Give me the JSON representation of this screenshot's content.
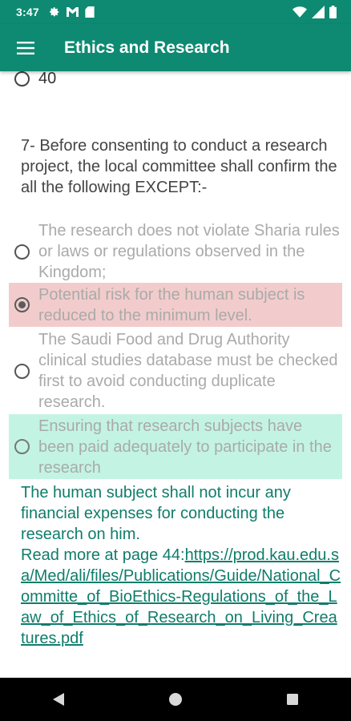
{
  "status_bar": {
    "time": "3:47",
    "left_icons": [
      "gear-icon",
      "gmail-icon",
      "sd-card-icon"
    ],
    "right_icons": [
      "wifi-icon",
      "signal-icon",
      "battery-icon"
    ]
  },
  "app_bar": {
    "title": "Ethics and Research",
    "menu_icon": "hamburger-menu-icon"
  },
  "prev_option": {
    "text": "40"
  },
  "question": {
    "text": "7- Before consenting to conduct a research project, the local committee shall confirm the all the following EXCEPT:-"
  },
  "options": [
    {
      "text": "The research does not violate Sharia rules or laws or regulations observed in the Kingdom;",
      "state": "normal",
      "selected": false
    },
    {
      "text": "Potential risk for the human subject is reduced to the minimum level.",
      "state": "wrong",
      "selected": true
    },
    {
      "text": "The Saudi Food and Drug Authority clinical studies database must be checked first to avoid conducting duplicate research.",
      "state": "normal",
      "selected": false
    },
    {
      "text": "Ensuring that research subjects have been paid adequately to participate in the research",
      "state": "correct",
      "selected": false
    }
  ],
  "explanation": {
    "text": "The human subject shall not incur any financial expenses for conducting the research on him.",
    "read_more_prefix": "Read more at page 44:",
    "link_text": "https://prod.kau.edu.sa/Med/ali/files/Publications/Guide/National_Committe_of_BioEthics-Regulations_of_the_Law_of_Ethics_of_Research_on_Living_Creatures.pdf"
  },
  "colors": {
    "primary": "#0e8a72",
    "wrong_highlight": "#f2cccc",
    "correct_highlight": "#c3f4e3",
    "explanation_text": "#0f7d6b",
    "muted_text": "#aaaaaa"
  },
  "nav_bar": {
    "buttons": [
      "back-triangle-icon",
      "home-circle-icon",
      "recents-square-icon"
    ]
  }
}
